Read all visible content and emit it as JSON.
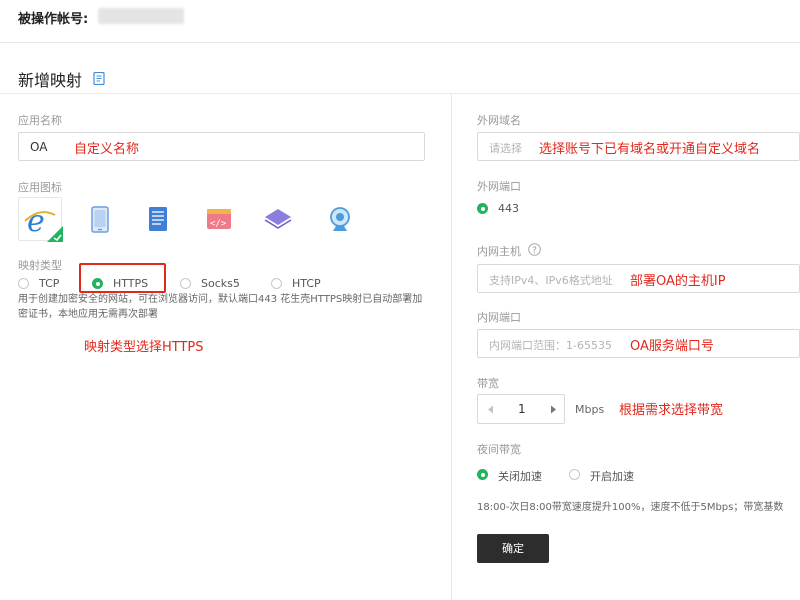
{
  "account": {
    "label": "被操作帐号:"
  },
  "section": {
    "title": "新增映射",
    "doc_icon": "document-icon"
  },
  "left": {
    "app_name_label": "应用名称",
    "app_name_value": "OA",
    "app_name_note": "自定义名称",
    "app_icon_label": "应用图标",
    "app_icons": [
      "ie-browser-icon",
      "phone-icon",
      "document-icon",
      "code-icon",
      "layers-icon",
      "camera-icon"
    ],
    "mapping_type_label": "映射类型",
    "mapping_types": [
      "TCP",
      "HTTPS",
      "Socks5",
      "HTCP"
    ],
    "mapping_type_selected": "HTTPS",
    "mapping_desc": "用于创建加密安全的网站，可在浏览器访问，默认端口443 花生壳HTTPS映射已自动部署加密证书，本地应用无需再次部署",
    "mapping_note": "映射类型选择HTTPS"
  },
  "right": {
    "domain_label": "外网域名",
    "domain_placeholder": "请选择",
    "domain_note": "选择账号下已有域名或开通自定义域名",
    "ext_port_label": "外网端口",
    "ext_port_value": "443",
    "host_label": "内网主机",
    "host_help_icon": "question-circle-icon",
    "host_placeholder": "支持IPv4、IPv6格式地址",
    "host_note": "部署OA的主机IP",
    "int_port_label": "内网端口",
    "int_port_placeholder": "内网端口范围：1-65535",
    "int_port_note": "OA服务端口号",
    "bandwidth_label": "带宽",
    "bandwidth_value": "1",
    "bandwidth_unit": "Mbps",
    "bandwidth_note": "根据需求选择带宽",
    "night_label": "夜间带宽",
    "night_options": [
      "关闭加速",
      "开启加速"
    ],
    "night_selected": "关闭加速",
    "night_hint": "18:00-次日8:00带宽速度提升100%，速度不低于5Mbps；带宽基数",
    "confirm_label": "确定"
  },
  "colors": {
    "accent_green": "#22b35e",
    "note_red": "#e0281c",
    "button_dark": "#2d2d2d"
  }
}
